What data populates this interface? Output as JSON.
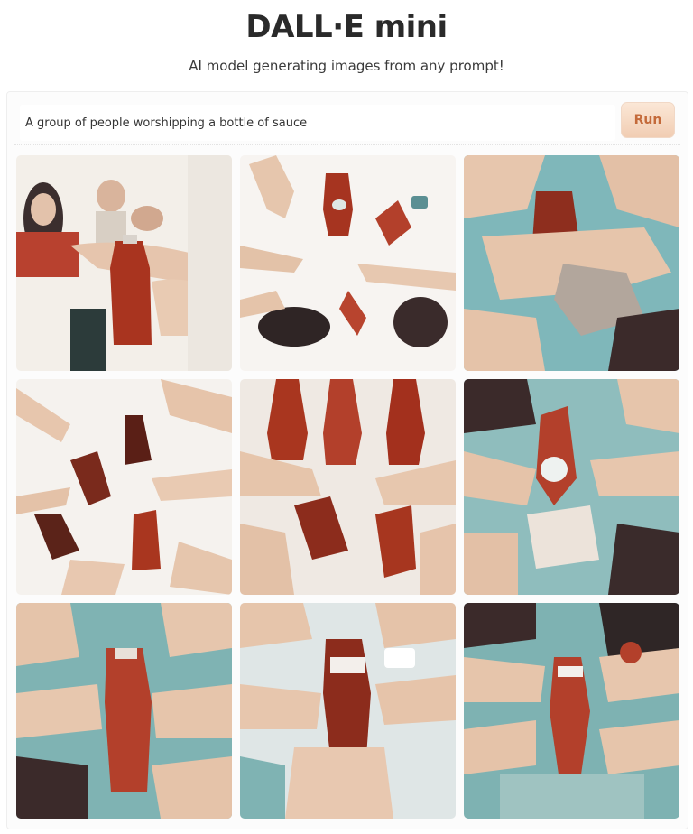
{
  "header": {
    "title": "DALL·E mini",
    "subtitle": "AI model generating images from any prompt!"
  },
  "prompt": {
    "value": "A group of people worshipping a bottle of sauce",
    "run_label": "Run"
  },
  "gallery": {
    "images": [
      {
        "name": "generated-image-1",
        "bg": "#f3efe9"
      },
      {
        "name": "generated-image-2",
        "bg": "#f7f4f1"
      },
      {
        "name": "generated-image-3",
        "bg": "#7fb7ba"
      },
      {
        "name": "generated-image-4",
        "bg": "#f5f2ee"
      },
      {
        "name": "generated-image-5",
        "bg": "#efe9e3"
      },
      {
        "name": "generated-image-6",
        "bg": "#8fbdbd"
      },
      {
        "name": "generated-image-7",
        "bg": "#7fb3b3"
      },
      {
        "name": "generated-image-8",
        "bg": "#dfe6e6"
      },
      {
        "name": "generated-image-9",
        "bg": "#7eb2b2"
      }
    ]
  },
  "colors": {
    "sauce": "#b3402b",
    "skin": "#e7c6ad",
    "teal": "#7fb7ba",
    "dark": "#3b2a2a",
    "run_text": "#c46a3a"
  }
}
